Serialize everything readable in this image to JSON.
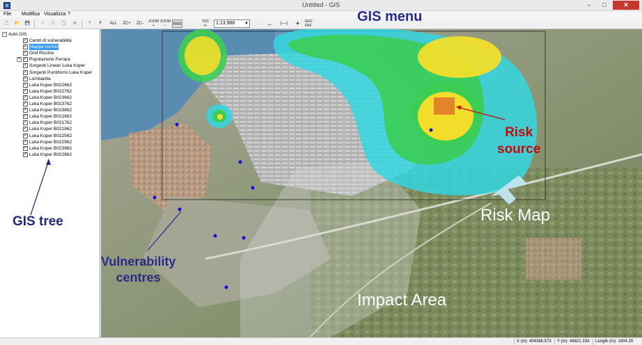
{
  "window": {
    "title": "Untitled - GIS",
    "minimize": "–",
    "maximize": "□",
    "close": "✕"
  },
  "menu": [
    "File",
    "Modifica",
    "Visualizza",
    "?"
  ],
  "toolbar": {
    "buttons": {
      "new": "🗋",
      "open": "📂",
      "save": "💾",
      "cut": "✂",
      "copy": "⎘",
      "paste": "📋",
      "print": "🖶",
      "help": "?",
      "f": "F",
      "all": "ALL",
      "zoom_plus": "ZC+",
      "zoom_minus": "ZC-",
      "zoom_in": "ZOOM +",
      "zoom_out": "ZOOM –",
      "pan": "PAN",
      "toc": "TOC +/-",
      "arrow_right": "→",
      "arrow_left": "←",
      "measure": "|----|",
      "cross": "+",
      "georef": "GEO REF"
    },
    "scale": "1:13,968"
  },
  "tree": {
    "root": "Auto GIS",
    "items": [
      {
        "label": "Centri di vulnerabilità",
        "checked": true,
        "selected": false,
        "expandable": false
      },
      {
        "label": "Mappa rischio",
        "checked": true,
        "selected": true,
        "expandable": false
      },
      {
        "label": "Grid Rischio",
        "checked": true,
        "selected": false,
        "expandable": false
      },
      {
        "label": "Popolazione Ferrara",
        "checked": true,
        "selected": false,
        "expandable": true
      },
      {
        "label": "Sorgenti Lineari Luka Koper",
        "checked": true,
        "selected": false,
        "expandable": false
      },
      {
        "label": "Sorgenti Puntiformi Luka Koper",
        "checked": true,
        "selected": false,
        "expandable": false
      },
      {
        "label": "Lombardia",
        "checked": true,
        "selected": false,
        "expandable": false
      },
      {
        "label": "Luka Koper B022662",
        "checked": true,
        "selected": false,
        "expandable": false
      },
      {
        "label": "Luka Koper B022762",
        "checked": true,
        "selected": false,
        "expandable": false
      },
      {
        "label": "Luka Koper B023662",
        "checked": true,
        "selected": false,
        "expandable": false
      },
      {
        "label": "Luka Koper B023762",
        "checked": true,
        "selected": false,
        "expandable": false
      },
      {
        "label": "Luka Koper B023862",
        "checked": true,
        "selected": false,
        "expandable": false
      },
      {
        "label": "Luka Koper B021662",
        "checked": true,
        "selected": false,
        "expandable": false
      },
      {
        "label": "Luka Koper B021762",
        "checked": true,
        "selected": false,
        "expandable": false
      },
      {
        "label": "Luka Koper B021862",
        "checked": true,
        "selected": false,
        "expandable": false
      },
      {
        "label": "Luka Koper B022562",
        "checked": true,
        "selected": false,
        "expandable": false
      },
      {
        "label": "Luka Koper B022962",
        "checked": true,
        "selected": false,
        "expandable": false
      },
      {
        "label": "Luka Koper B023962",
        "checked": true,
        "selected": false,
        "expandable": false
      },
      {
        "label": "Luka Koper B022862",
        "checked": true,
        "selected": false,
        "expandable": false
      }
    ]
  },
  "status": {
    "x": "X (m): 404368.573",
    "y": "Y (m): 44821.334",
    "length": "Length (m): 1404.29"
  },
  "annotations": {
    "gis_menu": "GIS menu",
    "gis_tree": "GIS tree",
    "vulnerability_line1": "Vulnerability",
    "vulnerability_line2": "centres",
    "risk_line1": "Risk",
    "risk_line2": "source",
    "risk_map": "Risk Map",
    "impact_area": "Impact Area"
  },
  "colors": {
    "risk_outer": "#34d6e0",
    "risk_mid": "#3ccd55",
    "risk_inner": "#f2de2a",
    "risk_source": "#e0732a",
    "vulnerability_point": "#1010e0",
    "annotation_blue": "#2a2a8f",
    "annotation_red": "#c20b0b",
    "sea": "#5a8bb0",
    "land": "#8f9a78"
  }
}
